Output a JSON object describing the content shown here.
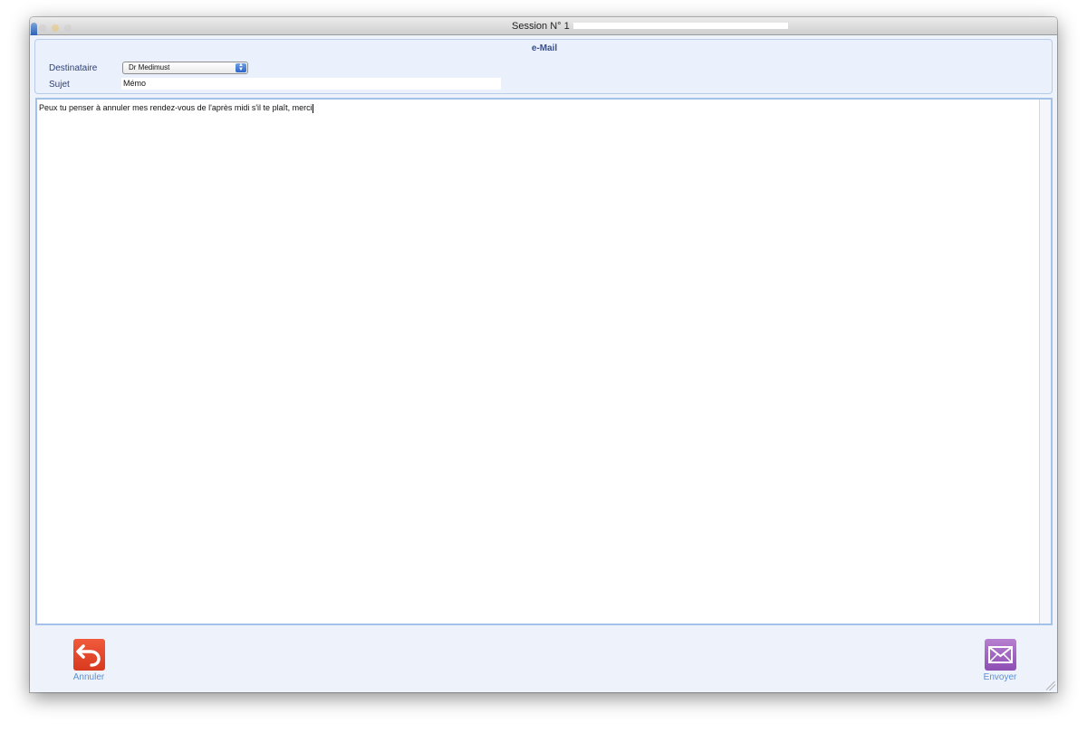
{
  "window": {
    "title": "Session N° 1"
  },
  "header": {
    "title": "e-Mail",
    "recipient_label": "Destinataire",
    "recipient_value": "Dr Medimust",
    "subject_label": "Sujet",
    "subject_value": "Mémo"
  },
  "message": {
    "body": "Peux tu penser à annuler mes rendez-vous de l'après midi s'il te plaît, merci"
  },
  "footer": {
    "cancel_label": "Annuler",
    "send_label": "Envoyer"
  },
  "colors": {
    "cancel_icon": "#e04a2e",
    "send_icon": "#a36ac4",
    "label_blue": "#5b8fd1",
    "panel_border": "#a4c1e9"
  },
  "icons": {
    "cancel": "undo-arrow-icon",
    "send": "envelope-icon"
  }
}
